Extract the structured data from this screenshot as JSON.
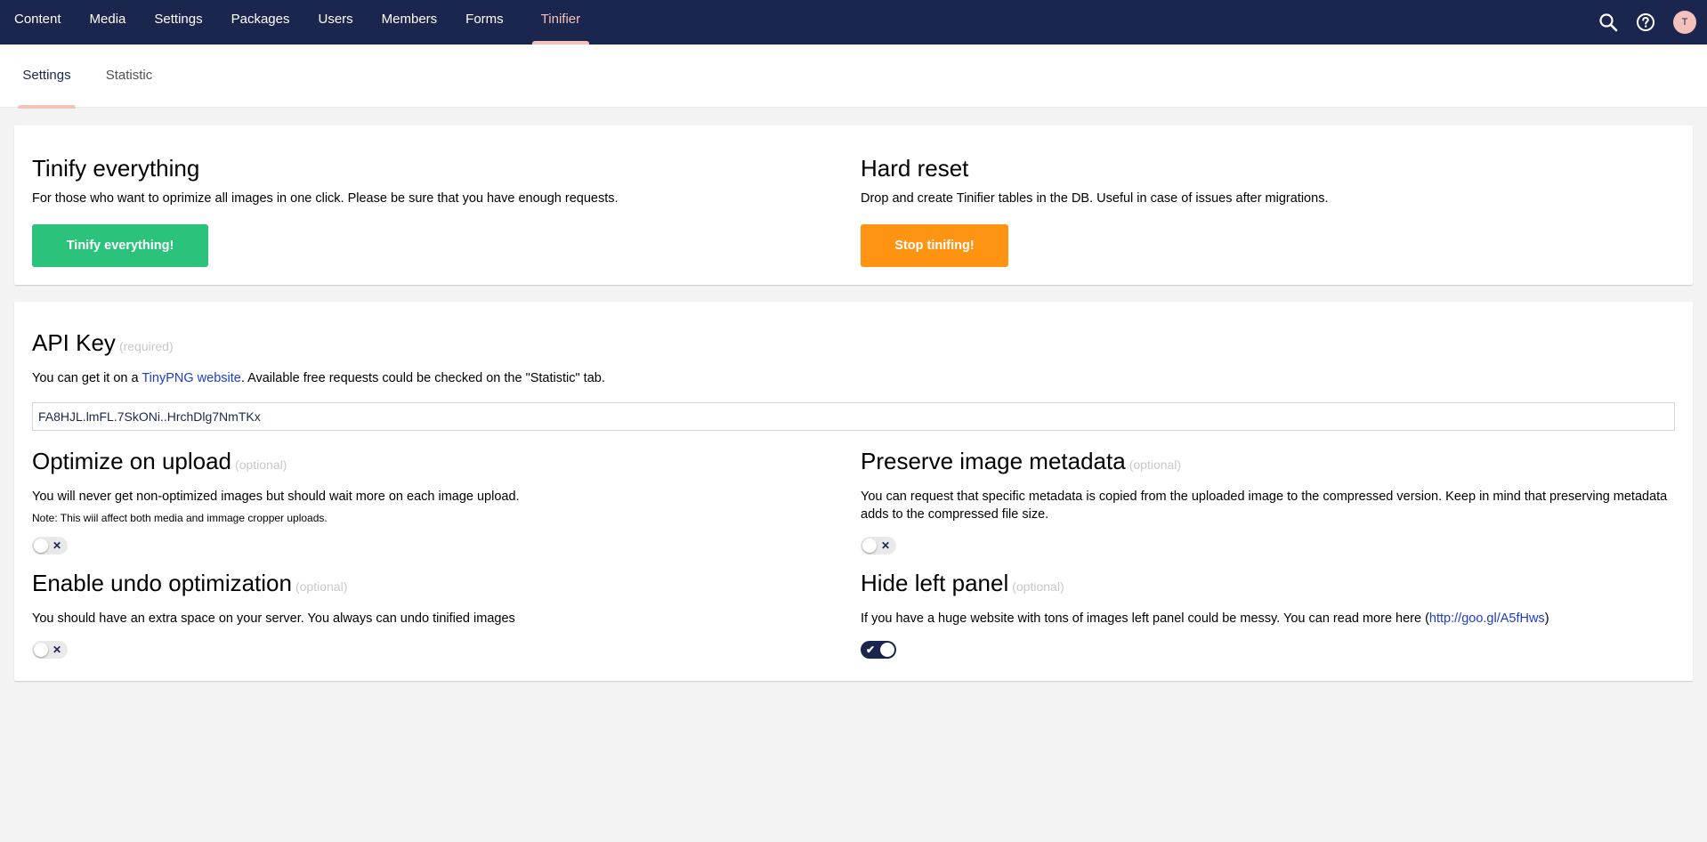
{
  "topnav": {
    "items": [
      "Content",
      "Media",
      "Settings",
      "Packages",
      "Users",
      "Members",
      "Forms",
      "Tinifier"
    ],
    "active": "Tinifier",
    "user_initial": "T",
    "icons": [
      "search-icon",
      "help-icon"
    ]
  },
  "subtabs": {
    "items": [
      "Settings",
      "Statistic"
    ],
    "active": "Settings"
  },
  "tinify": {
    "title": "Tinify everything",
    "desc": "For those who want to oprimize all images in one click. Please be sure that you have enough requests.",
    "button": "Tinify everything!"
  },
  "reset": {
    "title": "Hard reset",
    "desc": "Drop and create Tinifier tables in the DB. Useful in case of issues after migrations.",
    "button": "Stop tinifing!"
  },
  "api": {
    "title": "API Key",
    "tag": "(required)",
    "desc_prefix": "You can get it on a ",
    "link": "TinyPNG website",
    "desc_suffix": ". Available free requests could be checked on the \"Statistic\" tab.",
    "value": "FA8HJL.lmFL.7SkONi..HrchDlg7NmTKx"
  },
  "optimize": {
    "title": "Optimize on upload",
    "tag": "(optional)",
    "desc": "You will never get non-optimized images but should wait more on each image upload.",
    "note": "Note: This wiil affect both media and immage cropper uploads.",
    "enabled": false
  },
  "metadata": {
    "title": "Preserve image metadata",
    "tag": "(optional)",
    "desc": "You can request that specific metadata is copied from the uploaded image to the compressed version. Keep in mind that preserving metadata adds to the compressed file size.",
    "enabled": false
  },
  "undo": {
    "title": "Enable undo optimization",
    "tag": "(optional)",
    "desc": "You should have an extra space on your server. You always can undo tinified images",
    "enabled": false
  },
  "hidepanel": {
    "title": "Hide left panel",
    "tag": "(optional)",
    "desc_prefix": "If you have a huge website with tons of images left panel could be messy. You can read more here (",
    "link": "http://goo.gl/A5fHws",
    "desc_suffix": ")",
    "enabled": true
  },
  "toggle_marks": {
    "off": "✕",
    "on": "✔"
  },
  "colors": {
    "navbar": "#1b264f",
    "active_accent": "#f5c1bc",
    "green_button": "#2bc37c",
    "orange_button": "#ff9412",
    "link": "#1b3cd4"
  }
}
